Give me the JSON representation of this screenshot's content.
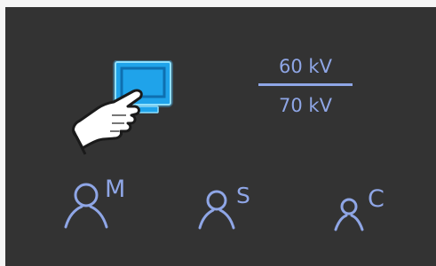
{
  "colors": {
    "panel_bg": "#333333",
    "accent": "#8fa6e6",
    "monitor_blue": "#1fa3ea",
    "monitor_glow": "#4cc3ff",
    "hand_fill": "#ffffff"
  },
  "voltage": {
    "upper": "60 kV",
    "lower": "70 kV"
  },
  "icons": {
    "monitor": "monitor-icon",
    "hand": "pointing-hand-icon",
    "user": "user-icon"
  },
  "users": [
    {
      "letter": "M"
    },
    {
      "letter": "S"
    },
    {
      "letter": "C"
    }
  ]
}
